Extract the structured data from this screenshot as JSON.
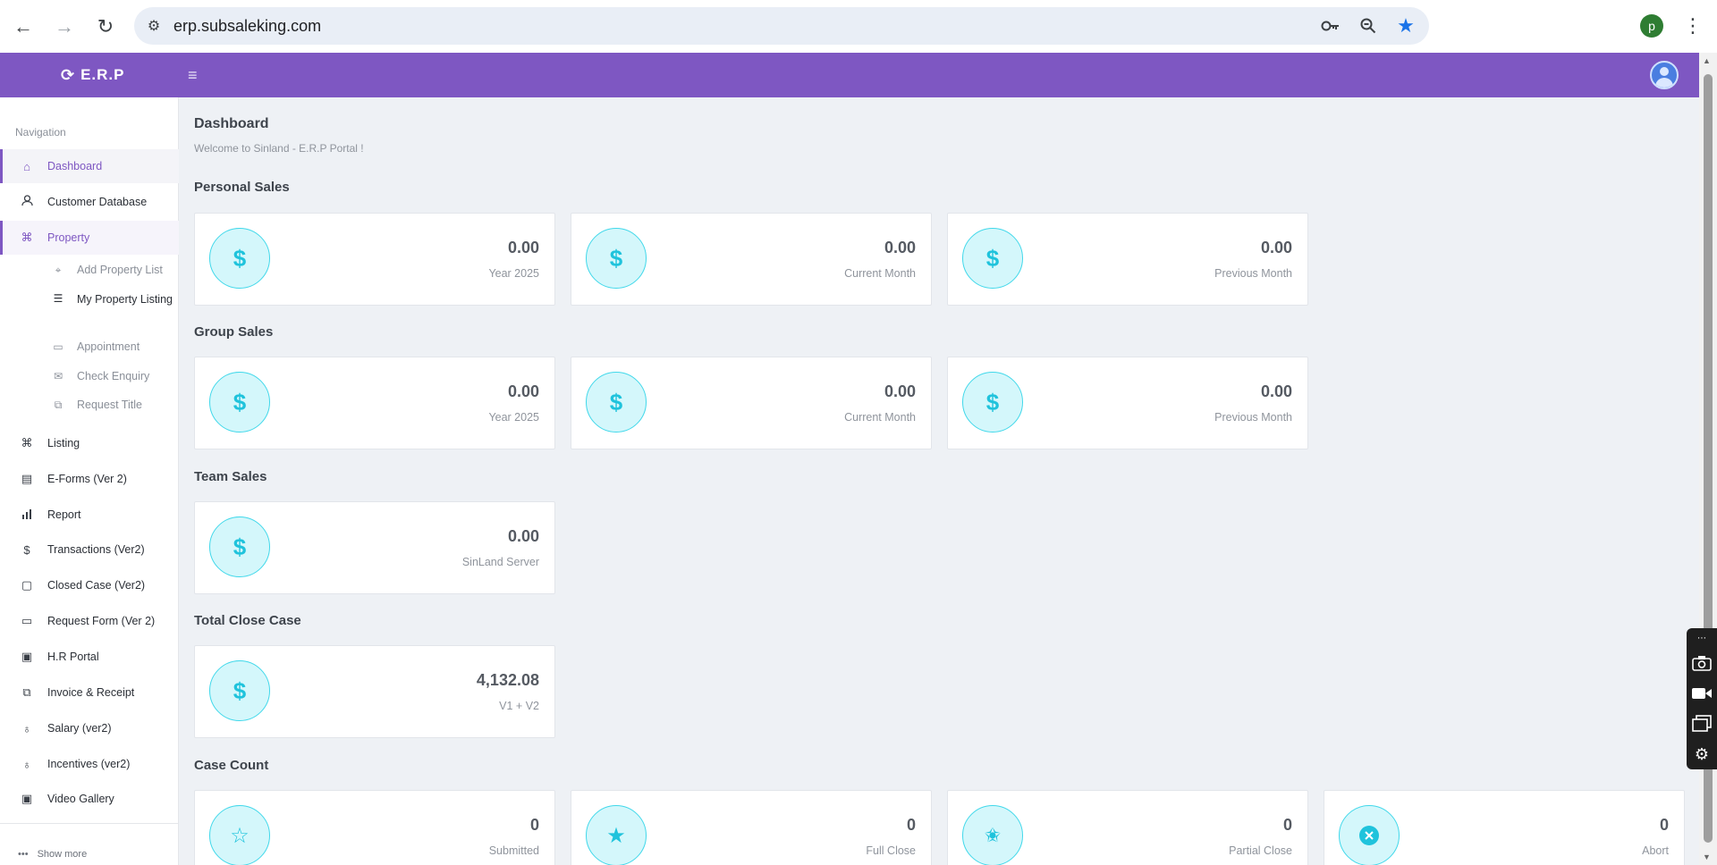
{
  "browser": {
    "url": "erp.subsaleking.com",
    "profile_initial": "p"
  },
  "header": {
    "logo_text": "E.R.P"
  },
  "sidebar": {
    "nav_title": "Navigation",
    "items": [
      {
        "label": "Dashboard"
      },
      {
        "label": "Customer Database"
      },
      {
        "label": "Property"
      },
      {
        "label": "Listing"
      },
      {
        "label": "E-Forms (Ver 2)"
      },
      {
        "label": "Report"
      },
      {
        "label": "Transactions (Ver2)"
      },
      {
        "label": "Closed Case (Ver2)"
      },
      {
        "label": "Request Form (Ver 2)"
      },
      {
        "label": "H.R Portal"
      },
      {
        "label": "Invoice & Receipt"
      },
      {
        "label": "Salary (ver2)"
      },
      {
        "label": "Incentives (ver2)"
      },
      {
        "label": "Video Gallery"
      }
    ],
    "property_sub": [
      {
        "label": "Add Property List"
      },
      {
        "label": "My Property Listing"
      },
      {
        "label": "Appointment"
      },
      {
        "label": "Check Enquiry"
      },
      {
        "label": "Request Title"
      }
    ],
    "show_more": "Show more"
  },
  "main": {
    "page_title": "Dashboard",
    "welcome": "Welcome to Sinland - E.R.P Portal !",
    "sections": {
      "personal_sales": {
        "title": "Personal Sales",
        "cards": [
          {
            "value": "0.00",
            "label": "Year 2025"
          },
          {
            "value": "0.00",
            "label": "Current Month"
          },
          {
            "value": "0.00",
            "label": "Previous Month"
          }
        ]
      },
      "group_sales": {
        "title": "Group Sales",
        "cards": [
          {
            "value": "0.00",
            "label": "Year 2025"
          },
          {
            "value": "0.00",
            "label": "Current Month"
          },
          {
            "value": "0.00",
            "label": "Previous Month"
          }
        ]
      },
      "team_sales": {
        "title": "Team Sales",
        "cards": [
          {
            "value": "0.00",
            "label": "SinLand Server"
          }
        ]
      },
      "total_close_case": {
        "title": "Total Close Case",
        "cards": [
          {
            "value": "4,132.08",
            "label": "V1 + V2"
          }
        ]
      },
      "case_count": {
        "title": "Case Count",
        "cards": [
          {
            "value": "0",
            "label": "Submitted"
          },
          {
            "value": "0",
            "label": "Full Close"
          },
          {
            "value": "0",
            "label": "Partial Close"
          },
          {
            "value": "0",
            "label": "Abort"
          }
        ]
      }
    }
  },
  "icons": {
    "dollar": "$",
    "star_outline": "☆",
    "star_filled": "★",
    "star_half": "✬",
    "close_circle": "✕"
  },
  "colors": {
    "brand_purple": "#7e57c2",
    "accent_cyan": "#1fc3dc",
    "icon_circle_bg": "#d4f7fb"
  }
}
